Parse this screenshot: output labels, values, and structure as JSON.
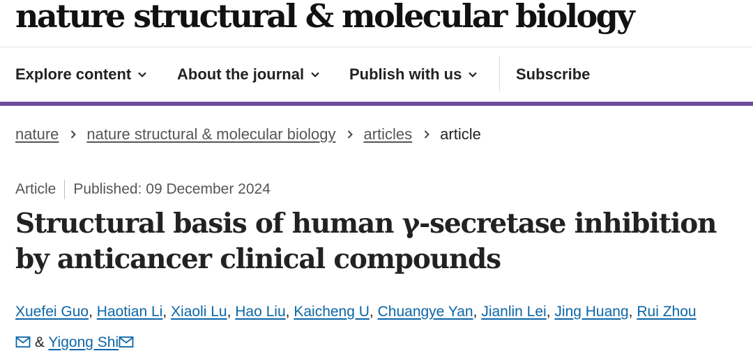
{
  "site": {
    "logo": "nature structural & molecular biology"
  },
  "nav": {
    "items": [
      {
        "label": "Explore content",
        "has_dropdown": true
      },
      {
        "label": "About the journal",
        "has_dropdown": true
      },
      {
        "label": "Publish with us",
        "has_dropdown": true
      },
      {
        "label": "Subscribe",
        "has_dropdown": false
      }
    ],
    "accent_color": "#6e4d9c"
  },
  "breadcrumb": {
    "items": [
      "nature",
      "nature structural & molecular biology",
      "articles"
    ],
    "current": "article"
  },
  "article": {
    "type": "Article",
    "published": "Published: 09 December 2024",
    "title": "Structural basis of human γ-secretase inhibition by anticancer clinical compounds",
    "authors": [
      "Xuefei Guo",
      "Haotian Li",
      "Xiaoli Lu",
      "Hao Liu",
      "Kaicheng U",
      "Chuangye Yan",
      "Jianlin Lei",
      "Jing Huang",
      "Rui Zhou",
      "Yigong Shi"
    ],
    "ampersand": "&",
    "comma": ",",
    "link_color": "#0b66a8",
    "icons": {
      "chevron": "chevron-down-icon",
      "separator": "chevron-right-icon",
      "email": "mail-icon"
    }
  }
}
